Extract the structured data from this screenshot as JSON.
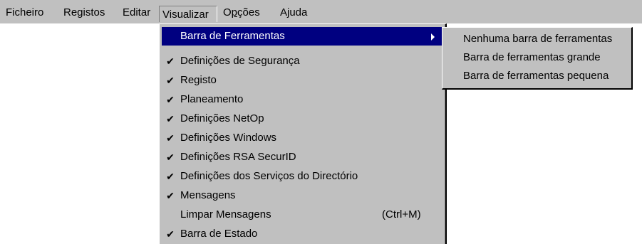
{
  "menubar": {
    "items": [
      {
        "label": "Ficheiro"
      },
      {
        "label": "Registos"
      },
      {
        "label": "Editar"
      },
      {
        "label": "Visualizar",
        "open": true
      },
      {
        "label_prefix": "O",
        "label_underlined": "p",
        "label_suffix": "ções"
      },
      {
        "label": "Ajuda"
      }
    ]
  },
  "view_menu": {
    "items": [
      {
        "label": "Barra de Ferramentas",
        "checked": false,
        "highlighted": true,
        "has_submenu": true,
        "arrow_icon": "submenu-arrow-icon"
      },
      {
        "label": "Definições de Segurança",
        "checked": true
      },
      {
        "label": "Registo",
        "checked": true
      },
      {
        "label": "Planeamento",
        "checked": true
      },
      {
        "label": "Definições NetOp",
        "checked": true
      },
      {
        "label": "Definições Windows",
        "checked": true
      },
      {
        "label": "Definições RSA SecurID",
        "checked": true
      },
      {
        "label": "Definições dos Serviços do Directório",
        "checked": true
      },
      {
        "label": "Mensagens",
        "checked": true
      },
      {
        "label": "Limpar Mensagens",
        "checked": false,
        "shortcut": "(Ctrl+M)"
      },
      {
        "label": "Barra de Estado",
        "checked": true
      }
    ],
    "check_glyph": "✔"
  },
  "toolbar_submenu": {
    "items": [
      {
        "label": "Nenhuma barra de ferramentas"
      },
      {
        "label": "Barra de ferramentas grande"
      },
      {
        "label": "Barra de ferramentas pequena"
      }
    ]
  },
  "colors": {
    "menu_background": "#c0c0c0",
    "highlight_background": "#000080",
    "highlight_text": "#ffffff"
  }
}
